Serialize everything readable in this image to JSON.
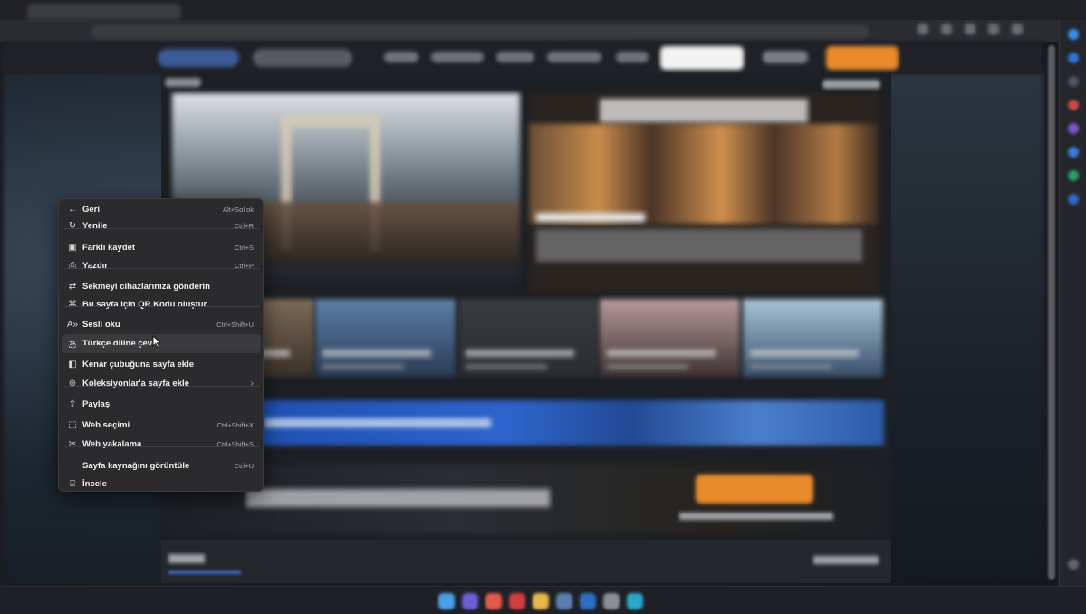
{
  "context_menu": {
    "items": [
      {
        "name": "back",
        "icon": "back-arrow-icon",
        "glyph": "←",
        "label": "Geri",
        "shortcut": "Alt+Sol ok"
      },
      {
        "name": "refresh",
        "icon": "refresh-icon",
        "glyph": "↻",
        "label": "Yenile",
        "shortcut": "Ctrl+R"
      },
      {
        "name": "save-as",
        "icon": "save-icon",
        "glyph": "▣",
        "label": "Farklı kaydet",
        "shortcut": "Ctrl+S"
      },
      {
        "name": "print",
        "icon": "print-icon",
        "glyph": "⎙",
        "label": "Yazdır",
        "shortcut": "Ctrl+P"
      },
      {
        "name": "send-tab",
        "icon": "send-device-icon",
        "glyph": "⇄",
        "label": "Sekmeyi cihazlarınıza gönderin",
        "shortcut": ""
      },
      {
        "name": "qr-code",
        "icon": "qr-code-icon",
        "glyph": "⌘",
        "label": "Bu sayfa için QR Kodu oluştur",
        "shortcut": ""
      },
      {
        "name": "read-aloud",
        "icon": "read-aloud-icon",
        "glyph": "A»",
        "label": "Sesli oku",
        "shortcut": "Ctrl+Shift+U"
      },
      {
        "name": "translate",
        "icon": "translate-icon",
        "glyph": "あ",
        "label": "Türkçe diline çevir",
        "shortcut": ""
      },
      {
        "name": "add-sidebar",
        "icon": "sidebar-add-icon",
        "glyph": "◧",
        "label": "Kenar çubuğuna sayfa ekle",
        "shortcut": ""
      },
      {
        "name": "add-collections",
        "icon": "collections-icon",
        "glyph": "⊕",
        "label": "Koleksiyonlar'a sayfa ekle",
        "shortcut": ""
      },
      {
        "name": "share",
        "icon": "share-icon",
        "glyph": "⇪",
        "label": "Paylaş",
        "shortcut": ""
      },
      {
        "name": "web-select",
        "icon": "web-select-icon",
        "glyph": "⬚",
        "label": "Web seçimi",
        "shortcut": "Ctrl+Shift+X"
      },
      {
        "name": "web-capture",
        "icon": "web-capture-icon",
        "glyph": "✂",
        "label": "Web yakalama",
        "shortcut": "Ctrl+Shift+S"
      },
      {
        "name": "view-source",
        "icon": "",
        "glyph": "",
        "label": "Sayfa kaynağını görüntüle",
        "shortcut": "Ctrl+U"
      },
      {
        "name": "inspect",
        "icon": "inspect-icon",
        "glyph": "⌸",
        "label": "İncele",
        "shortcut": ""
      }
    ],
    "collections_arrow": "›"
  },
  "colors": {
    "menu_bg": "#2b2b2d",
    "accent_orange": "#e98b2a",
    "accent_blue": "#2d64cc"
  }
}
